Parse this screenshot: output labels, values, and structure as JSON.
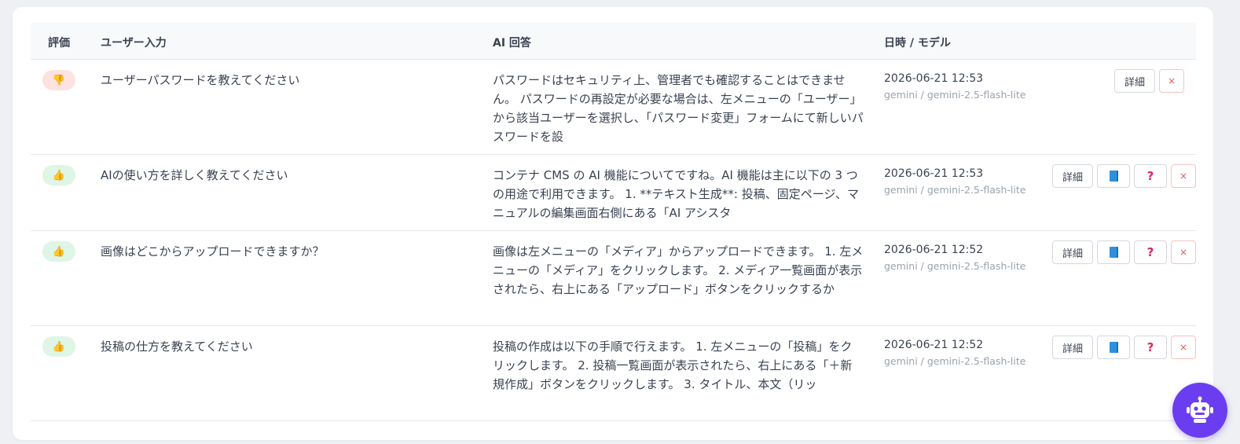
{
  "table": {
    "headers": {
      "rating": "評価",
      "input": "ユーザー入力",
      "answer": "AI 回答",
      "datetime_model": "日時 / モデル"
    },
    "rows": [
      {
        "rating": "thumbs-down",
        "rating_icon": "👎",
        "input": "ユーザーパスワードを教えてください",
        "answer": "パスワードはセキュリティ上、管理者でも確認することはできません。 パスワードの再設定が必要な場合は、左メニューの「ユーザー」から該当ユーザーを選択し、「パスワード変更」フォームにて新しいパスワードを設",
        "datetime": "2026-06-21 12:53",
        "model": "gemini / gemini-2.5-flash-lite"
      },
      {
        "rating": "thumbs-up",
        "rating_icon": "👍",
        "input": "AIの使い方を詳しく教えてください",
        "answer": "コンテナ CMS の AI 機能についてですね。AI 機能は主に以下の 3 つの用途で利用できます。 1. **テキスト生成**: 投稿、固定ページ、マニュアルの編集画面右側にある「AI アシスタ",
        "datetime": "2026-06-21 12:53",
        "model": "gemini / gemini-2.5-flash-lite"
      },
      {
        "rating": "thumbs-up",
        "rating_icon": "👍",
        "input": "画像はどこからアップロードできますか？",
        "answer": "画像は左メニューの「メディア」からアップロードできます。 1. 左メニューの「メディア」をクリックします。 2. メディア一覧画面が表示されたら、右上にある「アップロード」ボタンをクリックするか",
        "datetime": "2026-06-21 12:52",
        "model": "gemini / gemini-2.5-flash-lite"
      },
      {
        "rating": "thumbs-up",
        "rating_icon": "👍",
        "input": "投稿の仕方を教えてください",
        "answer": "投稿の作成は以下の手順で行えます。 1. 左メニューの「投稿」をクリックします。 2. 投稿一覧画面が表示されたら、右上にある「＋新規作成」ボタンをクリックします。 3. タイトル、本文（リッ",
        "datetime": "2026-06-21 12:52",
        "model": "gemini / gemini-2.5-flash-lite"
      }
    ],
    "actions": {
      "detail_label": "詳細",
      "question_label": "?",
      "delete_label": "×",
      "manual_icon": "book-icon"
    }
  },
  "colors": {
    "accent": "#6a3ef0",
    "thumbs_down_bg": "#fde2e2",
    "thumbs_up_bg": "#dff5e6",
    "delete": "#e25b5b",
    "question": "#e0245e"
  },
  "floating": {
    "icon": "robot-icon"
  }
}
